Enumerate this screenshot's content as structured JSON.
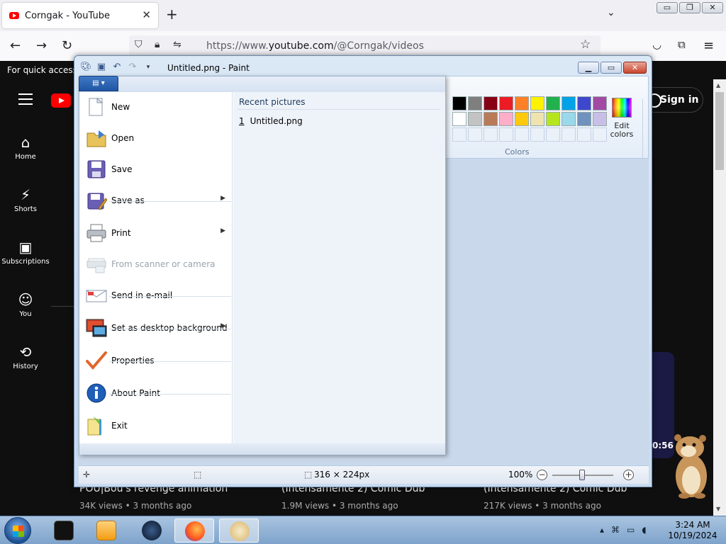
{
  "browser": {
    "tab_title": "Corngak - YouTube",
    "url_prefix": "https://www.",
    "url_domain": "youtube.com",
    "url_path": "/@Corngak/videos",
    "bookmarks_hint": "For quick access,",
    "icons": [
      "youtube-favicon",
      "close-icon",
      "plus-icon",
      "chevron-down-icon",
      "back-arrow-icon",
      "forward-arrow-icon",
      "reload-icon",
      "shield-icon",
      "lock-icon",
      "permissions-icon",
      "star-icon",
      "pocket-icon",
      "extensions-icon",
      "hamburger-menu-icon"
    ]
  },
  "youtube": {
    "sidebar": [
      {
        "label": "Home",
        "icon": "home-icon"
      },
      {
        "label": "Shorts",
        "icon": "shorts-icon"
      },
      {
        "label": "Subscriptions",
        "icon": "subscriptions-icon"
      },
      {
        "label": "You",
        "icon": "person-icon"
      },
      {
        "label": "History",
        "icon": "history-icon"
      }
    ],
    "signin_label": "Sign in",
    "videos": [
      {
        "title": "POU|Bou's revenge animation",
        "meta": "34K views • 3 months ago"
      },
      {
        "title": "(Intensamente 2) Comic Dub",
        "meta": "1.9M views • 3 months ago"
      },
      {
        "title": "(Intensamente 2) Comic Dub",
        "meta": "217K views • 3 months ago"
      }
    ],
    "duration_stub": "0:56",
    "accent": "#ff0000"
  },
  "paint": {
    "window_title": "Untitled.png - Paint",
    "app_menu": {
      "items": [
        {
          "label": "New",
          "icon": "new-file-icon",
          "enabled": true,
          "submenu": false
        },
        {
          "label": "Open",
          "icon": "open-folder-icon",
          "enabled": true,
          "submenu": false
        },
        {
          "label": "Save",
          "icon": "save-floppy-icon",
          "enabled": true,
          "submenu": false
        },
        {
          "label": "Save as",
          "icon": "save-as-icon",
          "enabled": true,
          "submenu": true
        },
        {
          "label": "Print",
          "icon": "printer-icon",
          "enabled": true,
          "submenu": true
        },
        {
          "label": "From scanner or camera",
          "icon": "scanner-icon",
          "enabled": false,
          "submenu": false
        },
        {
          "label": "Send in e-mail",
          "icon": "email-icon",
          "enabled": true,
          "submenu": false
        },
        {
          "label": "Set as desktop background",
          "icon": "desktop-background-icon",
          "enabled": true,
          "submenu": true
        },
        {
          "label": "Properties",
          "icon": "checkmark-icon",
          "enabled": true,
          "submenu": false
        },
        {
          "label": "About Paint",
          "icon": "info-icon",
          "enabled": true,
          "submenu": false
        },
        {
          "label": "Exit",
          "icon": "exit-icon",
          "enabled": true,
          "submenu": false
        }
      ],
      "recent_heading": "Recent pictures",
      "recent_items": [
        {
          "num": "1",
          "name": "Untitled.png"
        }
      ]
    },
    "colors": {
      "group_label": "Colors",
      "edit_colors_line1": "Edit",
      "edit_colors_line2": "colors",
      "row1": [
        "#000000",
        "#7f7f7f",
        "#880015",
        "#ed1c24",
        "#ff7f27",
        "#fff200",
        "#22b14c",
        "#00a2e8",
        "#3f48cc",
        "#a349a4"
      ],
      "row2": [
        "#ffffff",
        "#c3c3c3",
        "#b97a57",
        "#ffaec9",
        "#ffc90e",
        "#efe4b0",
        "#b5e61d",
        "#99d9ea",
        "#7092be",
        "#c8bfe7"
      ]
    },
    "status": {
      "dimensions": "316 × 224px",
      "zoom": "100%",
      "zoom_level": 100
    }
  },
  "taskbar": {
    "time": "3:24 AM",
    "date": "10/19/2024"
  }
}
